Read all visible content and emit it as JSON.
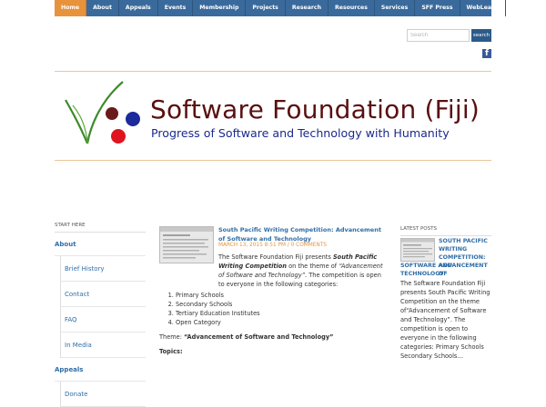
{
  "nav": {
    "items": [
      "Home",
      "About",
      "Appeals",
      "Events",
      "Membership",
      "Projects",
      "Research",
      "Resources",
      "Services",
      "SFF Press",
      "WebLearn"
    ],
    "active": "Home"
  },
  "search": {
    "placeholder": "Search",
    "button_label": "search"
  },
  "social": {
    "facebook_glyph": "f"
  },
  "header": {
    "title": "Software Foundation (Fiji)",
    "tagline": "Progress of Software and Technology with Humanity"
  },
  "left_sidebar": {
    "title": "START HERE",
    "about": "About",
    "about_children": [
      "Brief History",
      "Contact",
      "FAQ",
      "In Media"
    ],
    "appeals": "Appeals",
    "appeals_children": [
      "Donate"
    ]
  },
  "post": {
    "title": "South Pacific Writing Competition: Advancement of Software and Technology",
    "date": "MARCH 13, 2015 8:51 PM",
    "separator": " / ",
    "comments": "0 COMMENTS",
    "intro_1": "The Software Foundation Fiji presents ",
    "intro_em": "South Pacific Writing Competition",
    "intro_2": " on the theme of ",
    "intro_theme_em": "“Advancement of Software and Technology”",
    "intro_3": ". The competition is open to everyone in the following categories:",
    "categories": [
      "Primary Schools",
      "Secondary Schools",
      "Tertiary Education Institutes",
      "Open Category"
    ],
    "theme_label": "Theme: ",
    "theme_value": "“Advancement of Software and Technology”",
    "topics_label": "Topics:"
  },
  "right_sidebar": {
    "title": "LATEST POSTS",
    "post_title_a": "SOUTH PACIFIC WRITING COMPETITION: ADVANCEMENT OF",
    "post_title_b": "SOFTWARE AND TECHNOLOGY",
    "excerpt": "The Software Foundation Fiji presents South Pacific Writing Competition on the theme of“Advancement of Software and Technology”. The competition is open to everyone in the following categories: Primary Schools Secondary Schools…"
  },
  "colors": {
    "nav_bg": "#3a6a9c",
    "nav_active": "#e8923b",
    "link": "#2f6ea7",
    "title": "#5a1010",
    "tagline": "#1b2a8c",
    "meta": "#e8923b"
  }
}
